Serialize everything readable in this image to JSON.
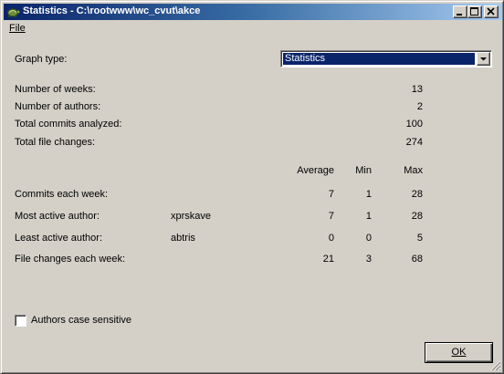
{
  "window": {
    "title": "Statistics - C:\\rootwww\\wc_cvut\\akce"
  },
  "menu": {
    "file": "File"
  },
  "graph_type": {
    "label": "Graph type:",
    "selected": "Statistics"
  },
  "summary": [
    {
      "label": "Number of weeks:",
      "value": "13"
    },
    {
      "label": "Number of authors:",
      "value": "2"
    },
    {
      "label": "Total commits analyzed:",
      "value": "100"
    },
    {
      "label": "Total file changes:",
      "value": "274"
    }
  ],
  "table": {
    "headers": {
      "average": "Average",
      "min": "Min",
      "max": "Max"
    },
    "rows": [
      {
        "label": "Commits each week:",
        "author": "",
        "average": "7",
        "min": "1",
        "max": "28"
      },
      {
        "label": "Most active author:",
        "author": "xprskave",
        "average": "7",
        "min": "1",
        "max": "28"
      },
      {
        "label": "Least active author:",
        "author": "abtris",
        "average": "0",
        "min": "0",
        "max": "5"
      },
      {
        "label": "File changes each week:",
        "author": "",
        "average": "21",
        "min": "3",
        "max": "68"
      }
    ]
  },
  "options": {
    "case_sensitive_label": "Authors case sensitive",
    "case_sensitive_checked": false
  },
  "buttons": {
    "ok": "OK"
  }
}
